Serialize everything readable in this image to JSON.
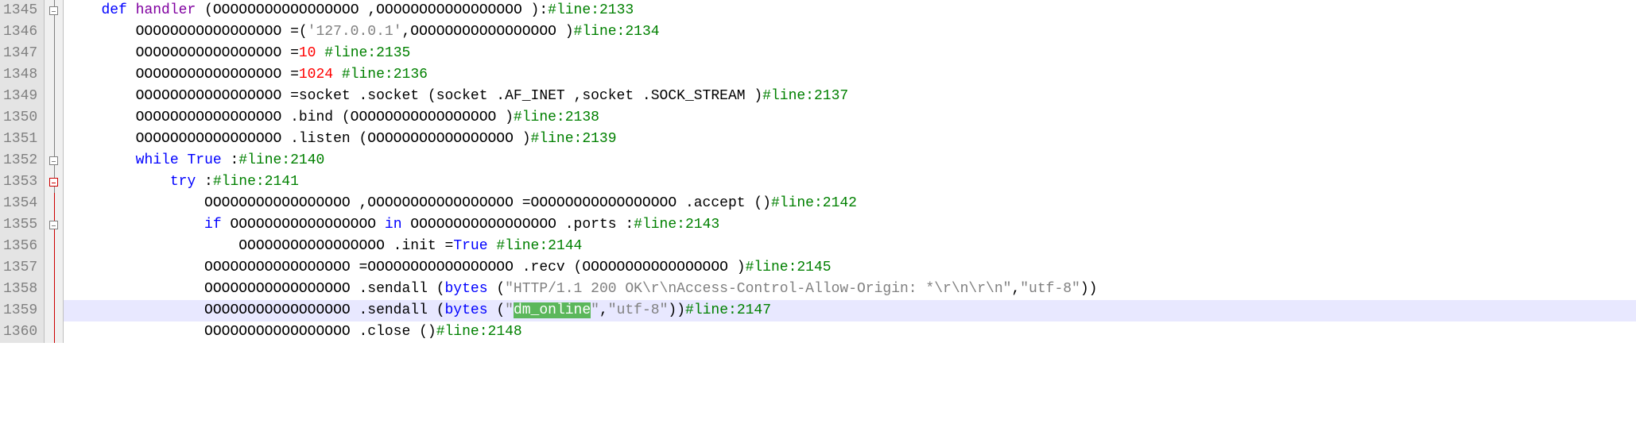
{
  "lines": [
    {
      "num": "1345",
      "fold": "box",
      "content": [
        {
          "t": "    ",
          "c": "plain"
        },
        {
          "t": "def",
          "c": "kw"
        },
        {
          "t": " ",
          "c": "plain"
        },
        {
          "t": "handler",
          "c": "fn"
        },
        {
          "t": " (OOOOOOOOOOOOOOOOO ,OOOOOOOOOOOOOOOOO ):",
          "c": "plain"
        },
        {
          "t": "#line:2133",
          "c": "com"
        }
      ]
    },
    {
      "num": "1346",
      "fold": "vert",
      "content": [
        {
          "t": "        OOOOOOOOOOOOOOOOO =(",
          "c": "plain"
        },
        {
          "t": "'127.0.0.1'",
          "c": "str"
        },
        {
          "t": ",OOOOOOOOOOOOOOOOO )",
          "c": "plain"
        },
        {
          "t": "#line:2134",
          "c": "com"
        }
      ]
    },
    {
      "num": "1347",
      "fold": "vert",
      "content": [
        {
          "t": "        OOOOOOOOOOOOOOOOO =",
          "c": "plain"
        },
        {
          "t": "10",
          "c": "num"
        },
        {
          "t": " ",
          "c": "plain"
        },
        {
          "t": "#line:2135",
          "c": "com"
        }
      ]
    },
    {
      "num": "1348",
      "fold": "vert",
      "content": [
        {
          "t": "        OOOOOOOOOOOOOOOOO =",
          "c": "plain"
        },
        {
          "t": "1024",
          "c": "num"
        },
        {
          "t": " ",
          "c": "plain"
        },
        {
          "t": "#line:2136",
          "c": "com"
        }
      ]
    },
    {
      "num": "1349",
      "fold": "vert",
      "content": [
        {
          "t": "        OOOOOOOOOOOOOOOOO =socket .socket (socket .AF_INET ,socket .SOCK_STREAM )",
          "c": "plain"
        },
        {
          "t": "#line:2137",
          "c": "com"
        }
      ]
    },
    {
      "num": "1350",
      "fold": "vert",
      "content": [
        {
          "t": "        OOOOOOOOOOOOOOOOO .bind (OOOOOOOOOOOOOOOOO )",
          "c": "plain"
        },
        {
          "t": "#line:2138",
          "c": "com"
        }
      ]
    },
    {
      "num": "1351",
      "fold": "vert",
      "content": [
        {
          "t": "        OOOOOOOOOOOOOOOOO .listen (OOOOOOOOOOOOOOOOO )",
          "c": "plain"
        },
        {
          "t": "#line:2139",
          "c": "com"
        }
      ]
    },
    {
      "num": "1352",
      "fold": "box",
      "content": [
        {
          "t": "        ",
          "c": "plain"
        },
        {
          "t": "while",
          "c": "kw"
        },
        {
          "t": " ",
          "c": "plain"
        },
        {
          "t": "True",
          "c": "const"
        },
        {
          "t": " :",
          "c": "plain"
        },
        {
          "t": "#line:2140",
          "c": "com"
        }
      ]
    },
    {
      "num": "1353",
      "fold": "box-red",
      "content": [
        {
          "t": "            ",
          "c": "plain"
        },
        {
          "t": "try",
          "c": "kw"
        },
        {
          "t": " :",
          "c": "plain"
        },
        {
          "t": "#line:2141",
          "c": "com"
        }
      ]
    },
    {
      "num": "1354",
      "fold": "vert-red",
      "content": [
        {
          "t": "                OOOOOOOOOOOOOOOOO ,OOOOOOOOOOOOOOOOO =OOOOOOOOOOOOOOOOO .accept ()",
          "c": "plain"
        },
        {
          "t": "#line:2142",
          "c": "com"
        }
      ]
    },
    {
      "num": "1355",
      "fold": "box-red-vert",
      "content": [
        {
          "t": "                ",
          "c": "plain"
        },
        {
          "t": "if",
          "c": "kw"
        },
        {
          "t": " OOOOOOOOOOOOOOOOO ",
          "c": "plain"
        },
        {
          "t": "in",
          "c": "kw"
        },
        {
          "t": " OOOOOOOOOOOOOOOOO .ports :",
          "c": "plain"
        },
        {
          "t": "#line:2143",
          "c": "com"
        }
      ]
    },
    {
      "num": "1356",
      "fold": "vert-red",
      "content": [
        {
          "t": "                    OOOOOOOOOOOOOOOOO .init =",
          "c": "plain"
        },
        {
          "t": "True",
          "c": "const"
        },
        {
          "t": " ",
          "c": "plain"
        },
        {
          "t": "#line:2144",
          "c": "com"
        }
      ]
    },
    {
      "num": "1357",
      "fold": "vert-red",
      "content": [
        {
          "t": "                OOOOOOOOOOOOOOOOO =OOOOOOOOOOOOOOOOO .recv (OOOOOOOOOOOOOOOOO )",
          "c": "plain"
        },
        {
          "t": "#line:2145",
          "c": "com"
        }
      ]
    },
    {
      "num": "1358",
      "fold": "vert-red",
      "content": [
        {
          "t": "                OOOOOOOOOOOOOOOOO .sendall (",
          "c": "plain"
        },
        {
          "t": "bytes",
          "c": "kw"
        },
        {
          "t": " (",
          "c": "plain"
        },
        {
          "t": "\"HTTP/1.1 200 OK\\r\\nAccess-Control-Allow-Origin: *\\r\\n\\r\\n\"",
          "c": "str"
        },
        {
          "t": ",",
          "c": "plain"
        },
        {
          "t": "\"utf-8\"",
          "c": "str"
        },
        {
          "t": "))",
          "c": "plain"
        }
      ]
    },
    {
      "num": "1359",
      "fold": "vert-red",
      "highlight": true,
      "content": [
        {
          "t": "                OOOOOOOOOOOOOOOOO .sendall (",
          "c": "plain"
        },
        {
          "t": "bytes",
          "c": "kw"
        },
        {
          "t": " (",
          "c": "plain"
        },
        {
          "t": "\"",
          "c": "str"
        },
        {
          "t": "dm_online",
          "c": "highlight-text"
        },
        {
          "t": "\"",
          "c": "str"
        },
        {
          "t": ",",
          "c": "plain"
        },
        {
          "t": "\"utf-8\"",
          "c": "str"
        },
        {
          "t": "))",
          "c": "plain"
        },
        {
          "t": "#line:2147",
          "c": "com"
        }
      ]
    },
    {
      "num": "1360",
      "fold": "vert-red",
      "content": [
        {
          "t": "                OOOOOOOOOOOOOOOOO .close ()",
          "c": "plain"
        },
        {
          "t": "#line:2148",
          "c": "com"
        }
      ]
    }
  ]
}
